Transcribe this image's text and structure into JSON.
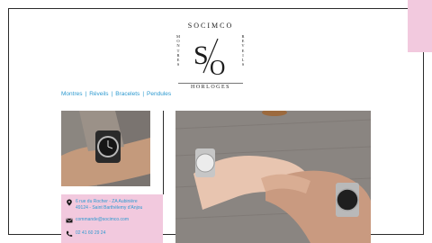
{
  "logo": {
    "brand": "SOCIMCO",
    "left_word": "MONTRES",
    "right_word": "REVEILS",
    "bottom_word": "HORLOGES",
    "monogram_left": "S",
    "monogram_right": "O"
  },
  "nav": {
    "items": [
      {
        "label": "Montres"
      },
      {
        "label": "Réveils"
      },
      {
        "label": "Bracelets"
      },
      {
        "label": "Pendules"
      }
    ],
    "separator": "|"
  },
  "contact": {
    "address_line1": "6 rue du Rocher - ZA Aubinière",
    "address_line2": "49124 - Saint Barthélemy d'Anjou",
    "email": "commande@socimco.com",
    "phone": "02 41 60 29 24"
  },
  "colors": {
    "accent_pink": "#f2c9de",
    "link_blue": "#2e9ad0",
    "frame": "#2b2b2b"
  },
  "icons": [
    "location-pin-icon",
    "envelope-icon",
    "phone-icon"
  ]
}
